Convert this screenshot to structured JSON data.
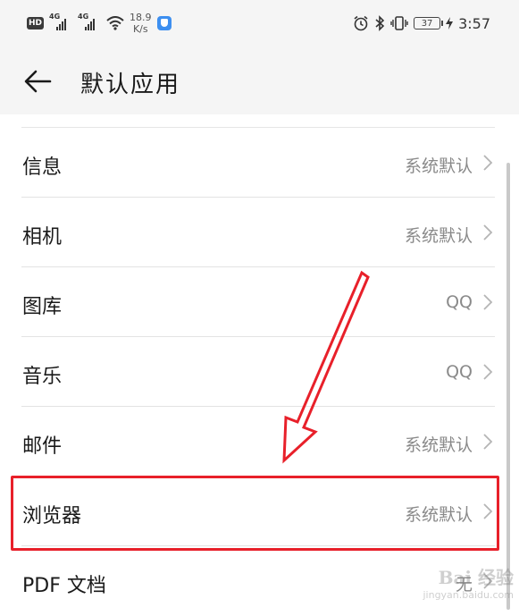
{
  "status_bar": {
    "hd_badge": "HD",
    "signal1_label": "4G",
    "signal2_label": "4G",
    "speed_value": "18.9",
    "speed_unit": "K/s",
    "battery": "37",
    "time": "3:57",
    "icons": [
      "hd-icon",
      "signal-icon",
      "signal-icon",
      "wifi-icon",
      "security-app-icon",
      "alarm-icon",
      "bluetooth-icon",
      "vibrate-icon",
      "battery-icon",
      "charging-icon"
    ]
  },
  "header": {
    "title": "默认应用",
    "back_icon": "arrow-left-icon"
  },
  "list": {
    "items": [
      {
        "name": "信息",
        "value": "系统默认"
      },
      {
        "name": "相机",
        "value": "系统默认"
      },
      {
        "name": "图库",
        "value": "QQ"
      },
      {
        "name": "音乐",
        "value": "QQ"
      },
      {
        "name": "邮件",
        "value": "系统默认"
      },
      {
        "name": "浏览器",
        "value": "系统默认"
      },
      {
        "name": "PDF 文档",
        "value": "无"
      }
    ],
    "chevron_icon": "chevron-right-icon"
  },
  "annotation": {
    "highlight_color": "#e8202a",
    "highlighted_item": "浏览器"
  },
  "watermark": {
    "line1": "Bai 经验",
    "line2": "jingyan.baidu.com"
  },
  "colors": {
    "header_bg": "#f5f5f5",
    "value_text": "#8a8a8a",
    "annotation_red": "#e8202a"
  }
}
